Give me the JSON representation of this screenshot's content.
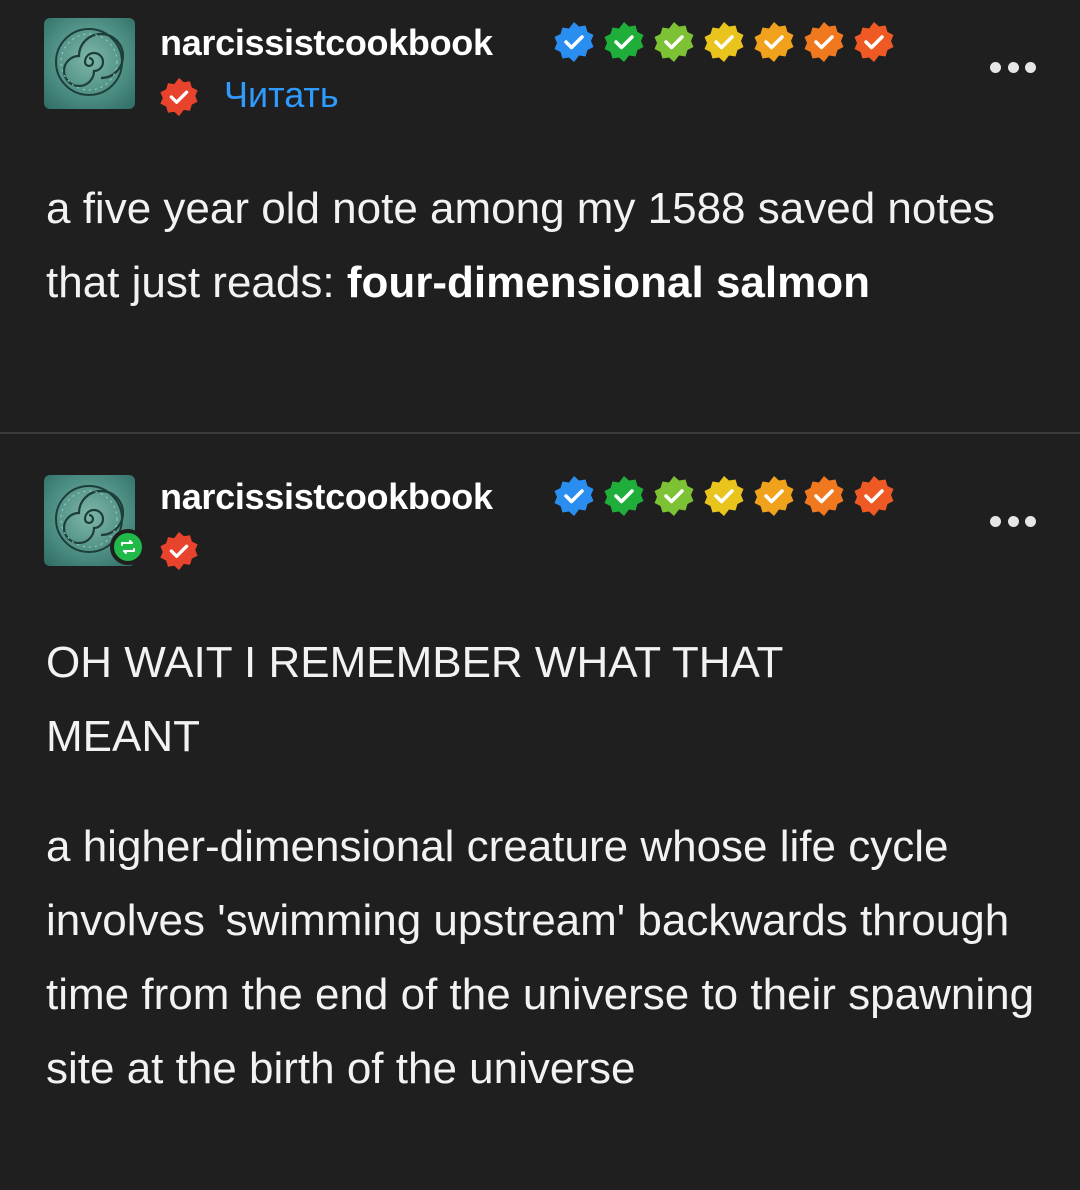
{
  "post1": {
    "username": "narcissistcookbook",
    "follow_label": "Читать",
    "text_plain": "a five year old note among my 1588 saved notes that just reads: ",
    "text_bold": "four-dimensional salmon"
  },
  "post2": {
    "username": "narcissistcookbook",
    "heading": "OH WAIT I REMEMBER WHAT THAT MEANT",
    "body": "a higher-dimensional creature whose life cycle involves 'swimming upstream' backwards through time from the end of the universe to their spawning site at the birth of the universe"
  },
  "badge_colors": [
    "#2a8ef0",
    "#1fae3a",
    "#7cc234",
    "#e9c41d",
    "#f0a21c",
    "#f0781f",
    "#ef5a24",
    "#e8432c"
  ],
  "icons": {
    "avatar": "ammonite-shell-avatar",
    "verified": "verified-check-badge",
    "more": "more-dots-icon",
    "reblog": "reblog-icon"
  }
}
